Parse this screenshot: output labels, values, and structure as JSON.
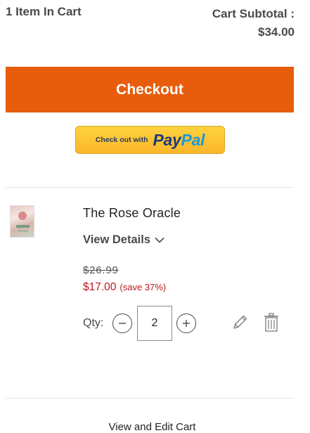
{
  "cart_summary": {
    "item_count_text": "1 Item In Cart",
    "subtotal_label": "Cart Subtotal :",
    "subtotal_value": "$34.00"
  },
  "checkout": {
    "button_label": "Checkout",
    "color": "#e85d0c"
  },
  "paypal": {
    "prefix_text": "Check out with",
    "logo_pay": "Pay",
    "logo_pal": "Pal"
  },
  "item": {
    "name": "The Rose Oracle",
    "view_details_label": "View Details",
    "view_details_icon": "chevron-down-icon",
    "original_price": "$26.99",
    "sale_price": "$17.00",
    "savings_text": "(save 37%)",
    "sale_color": "#c0161d",
    "qty_label": "Qty:",
    "quantity": "2",
    "decrement_icon": "minus-circle-icon",
    "increment_icon": "plus-circle-icon",
    "edit_icon": "pencil-icon",
    "delete_icon": "trash-icon"
  },
  "footer": {
    "view_edit_label": "View and Edit Cart"
  }
}
